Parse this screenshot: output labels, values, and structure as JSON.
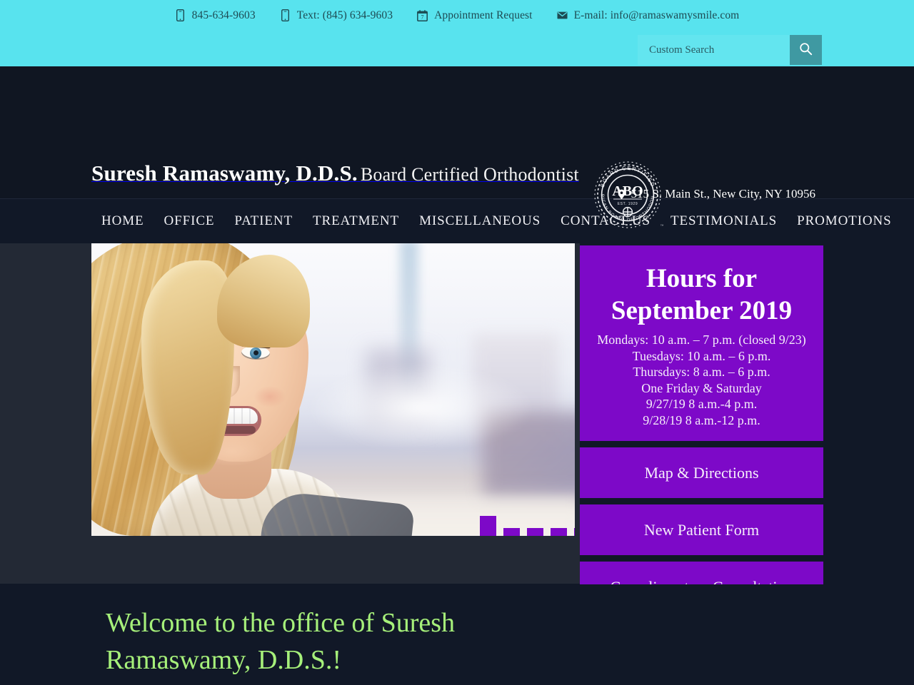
{
  "topbar": {
    "contacts": [
      {
        "icon": "mobile-phone-icon",
        "label": "845-634-9603",
        "name": "phone-link"
      },
      {
        "icon": "mobile-phone-icon",
        "label": "Text: (845) 634-9603",
        "name": "text-link"
      },
      {
        "icon": "calendar-icon",
        "label": "Appointment Request",
        "name": "appointment-request-link"
      },
      {
        "icon": "envelope-icon",
        "label": "E-mail: info@ramaswamysmile.com",
        "name": "email-link"
      }
    ],
    "search": {
      "placeholder": "Custom Search",
      "value": "",
      "button_icon": "search-icon"
    },
    "bg_color": "#58E3EE",
    "search_button_color": "#3F99A2"
  },
  "masthead": {
    "brand_line1": "Suresh Ramaswamy, D.D.S.",
    "brand_line2": "Board Certified Orthodontist",
    "seal": {
      "icon": "abo-seal-icon",
      "center": "ABO",
      "top_arc": "BOARD CERTIFIED",
      "bottom_arc": "AMERICAN BOARD OF ORTHODONTICS",
      "established": "EST. 1929",
      "trademark": "™"
    },
    "address": "515 S. Main St., New City, NY 10956",
    "address_icon": "map-pin-icon",
    "bg_color": "#101622"
  },
  "nav": {
    "items": [
      {
        "label": "HOME",
        "name": "nav-item-home"
      },
      {
        "label": "OFFICE",
        "name": "nav-item-office"
      },
      {
        "label": "PATIENT",
        "name": "nav-item-patient"
      },
      {
        "label": "TREATMENT",
        "name": "nav-item-treatment"
      },
      {
        "label": "MISCELLANEOUS",
        "name": "nav-item-miscellaneous"
      },
      {
        "label": "CONTACT US",
        "name": "nav-item-contact-us"
      },
      {
        "label": "TESTIMONIALS",
        "name": "nav-item-testimonials"
      },
      {
        "label": "PROMOTIONS",
        "name": "nav-item-promotions"
      }
    ]
  },
  "hero": {
    "alt": "Smiling blonde woman wearing a cream scarf with a blurred city background",
    "pager": {
      "total": 5,
      "active_index": 1
    }
  },
  "sidebar": {
    "hours": {
      "title_line1": "Hours for",
      "title_line2": "September 2019",
      "lines": [
        "Mondays: 10 a.m. – 7 p.m. (closed 9/23)",
        "Tuesdays: 10 a.m. – 6 p.m.",
        "Thursdays: 8 a.m. – 6 p.m.",
        "One Friday & Saturday",
        "9/27/19 8 a.m.-4 p.m.",
        "9/28/19 8 a.m.-12 p.m."
      ]
    },
    "buttons": [
      {
        "label": "Map & Directions",
        "name": "map-and-directions-button"
      },
      {
        "label": "New Patient Form",
        "name": "new-patient-form-button"
      },
      {
        "label": "Complimentary Consultation",
        "name": "complimentary-consultation-button"
      }
    ],
    "accent_color": "#7D09C8"
  },
  "welcome": {
    "title": "Welcome to the office of Suresh Ramaswamy, D.D.S.!",
    "title_color": "#A6F07A"
  }
}
